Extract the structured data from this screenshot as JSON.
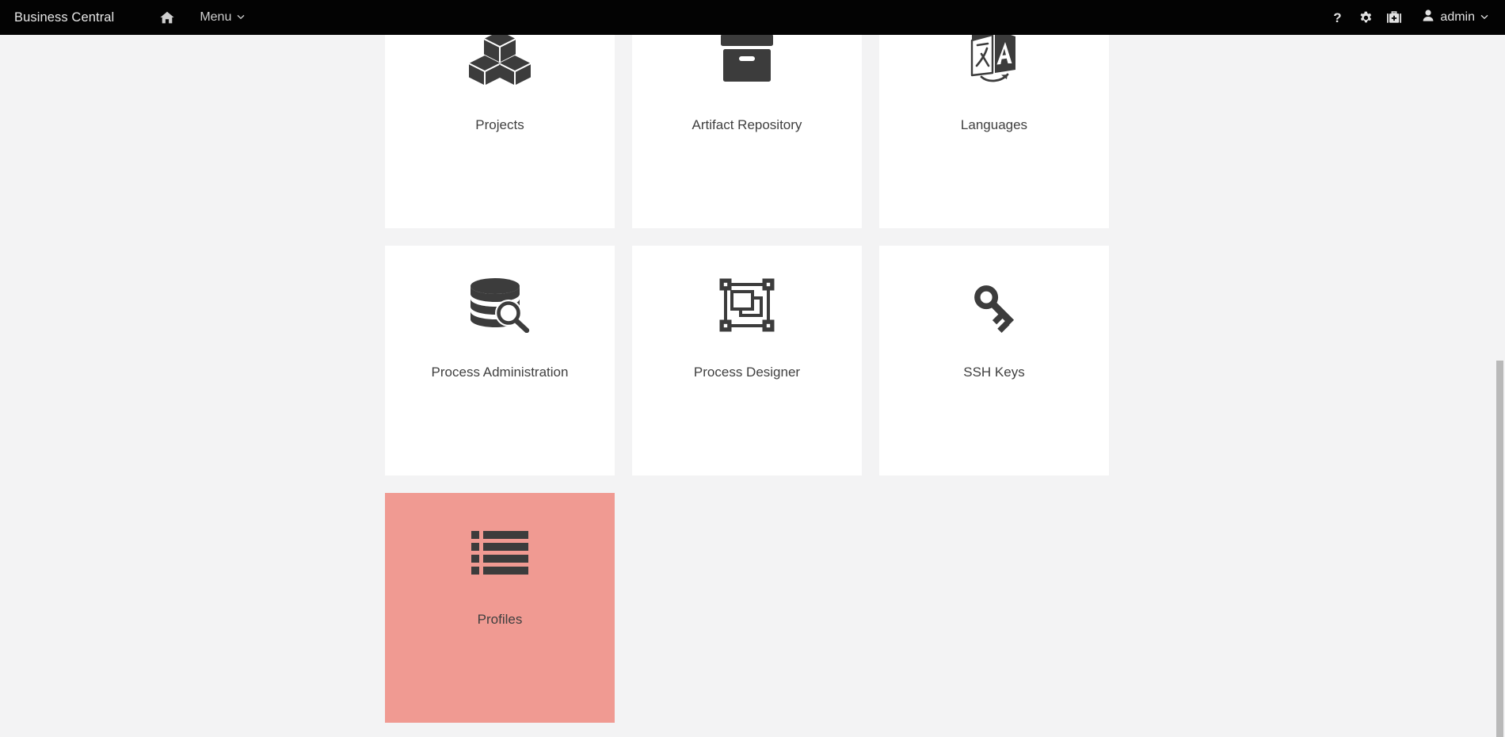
{
  "navbar": {
    "brand": "Business Central",
    "home_icon": "home-icon",
    "menu_label": "Menu",
    "menu_caret_icon": "chevron-down-icon",
    "help_label": "?",
    "help_icon": "question-mark-icon",
    "settings_icon": "gear-icon",
    "toolbox_icon": "toolbox-kit-icon",
    "user_icon": "user-icon",
    "user_name": "admin",
    "user_caret_icon": "chevron-down-icon",
    "background_color": "#030303",
    "text_color": "#e2e2e2"
  },
  "page": {
    "background_color": "#f3f3f4",
    "tile_background_color": "#ffffff",
    "highlight_color": "#f09a92",
    "label_color": "#3f3f3f",
    "icon_color": "#3c3c3c"
  },
  "tiles": {
    "rows": [
      [
        {
          "label": "Projects",
          "icon": "cubes-icon",
          "highlighted": false
        },
        {
          "label": "Artifact Repository",
          "icon": "archive-box-icon",
          "highlighted": false
        },
        {
          "label": "Languages",
          "icon": "translate-icon",
          "highlighted": false
        }
      ],
      [
        {
          "label": "Process Administration",
          "icon": "database-search-icon",
          "highlighted": false
        },
        {
          "label": "Process Designer",
          "icon": "object-group-icon",
          "highlighted": false
        },
        {
          "label": "SSH Keys",
          "icon": "key-icon",
          "highlighted": false
        }
      ],
      [
        {
          "label": "Profiles",
          "icon": "list-icon",
          "highlighted": true
        }
      ]
    ]
  },
  "scrollbar": {
    "track_color": "#f3f3f4",
    "thumb_color": "#b9b9b9",
    "orientation": "vertical"
  }
}
